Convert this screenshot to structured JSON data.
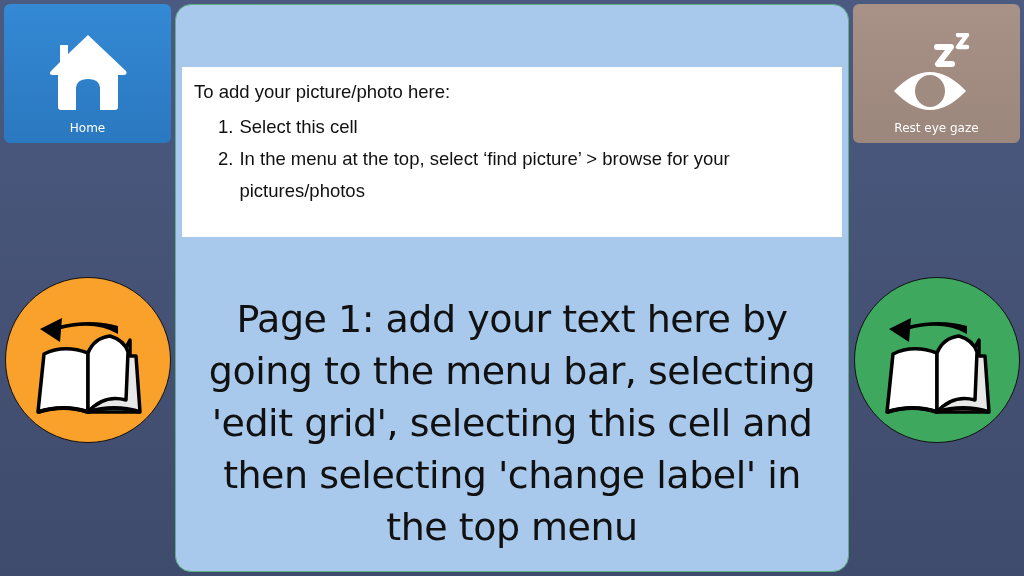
{
  "top_tiles": [
    {
      "kind": "home",
      "label": "Home"
    },
    {
      "kind": "rest",
      "label": "Rest eye gaze"
    }
  ],
  "page_buttons": [
    {
      "color": "#f9a12a"
    },
    {
      "color": "#3fa85f"
    }
  ],
  "content_cell": {
    "instructions": {
      "heading": "To add your picture/photo here:",
      "steps": [
        {
          "number": "1.",
          "text": "Select this cell"
        },
        {
          "number": "2.",
          "text": "In the menu at the top, select ‘find picture’ > browse for your pictures/photos"
        }
      ]
    },
    "label": "Page 1: add your text here by going to the menu bar, selecting 'edit grid', selecting this cell and then selecting 'change label' in the top menu"
  }
}
